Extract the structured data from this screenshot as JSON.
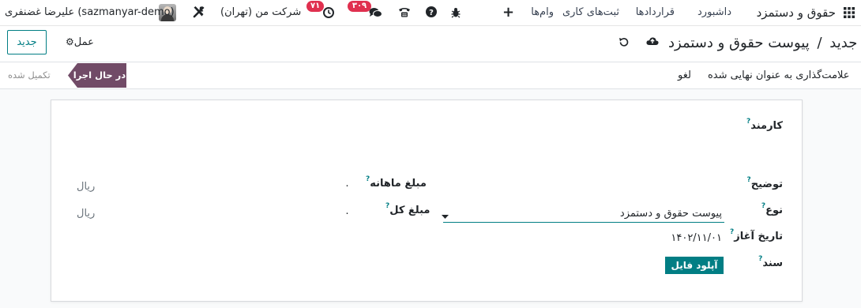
{
  "navbar": {
    "app_title": "حقوق و دستمزد",
    "menu": [
      "داشبورد",
      "قراردادها",
      "ثبت‌های کاری",
      "وام‌ها"
    ],
    "messages_count": "۳۰۹",
    "activities_count": "۷۱",
    "company": "شرکت من (تهران)",
    "user": "علیرضا غضنفری (sazmanyar-demo)"
  },
  "control": {
    "breadcrumb_parent": "پیوست حقوق و دستمزد",
    "breadcrumb_sep": "/",
    "breadcrumb_current": "جدید",
    "action_label": "عمل",
    "new_button": "جدید"
  },
  "statusbar": {
    "mark_final": "علامت‌گذاری به عنوان نهایی شده",
    "cancel": "لغو",
    "stage_active": "در حال اجرا",
    "stage_done": "تکمیل شده"
  },
  "form": {
    "employee_label": "کارمند",
    "description_label": "توضیح",
    "type_label": "نوع",
    "type_value": "پیوست حقوق و دستمزد",
    "start_date_label": "تاریخ آغاز",
    "start_date_value": "۱۴۰۲/۱۱/۰۱",
    "document_label": "سند",
    "upload_button": "آپلود فایل",
    "monthly_amount_label": "مبلغ ماهانه",
    "monthly_amount_value": "۰",
    "total_amount_label": "مبلغ کل",
    "total_amount_value": "۰",
    "currency": "ریال",
    "help_mark": "?"
  },
  "colors": {
    "primary": "#017e84",
    "stage_active": "#714b67",
    "badge": "#e0304f"
  }
}
